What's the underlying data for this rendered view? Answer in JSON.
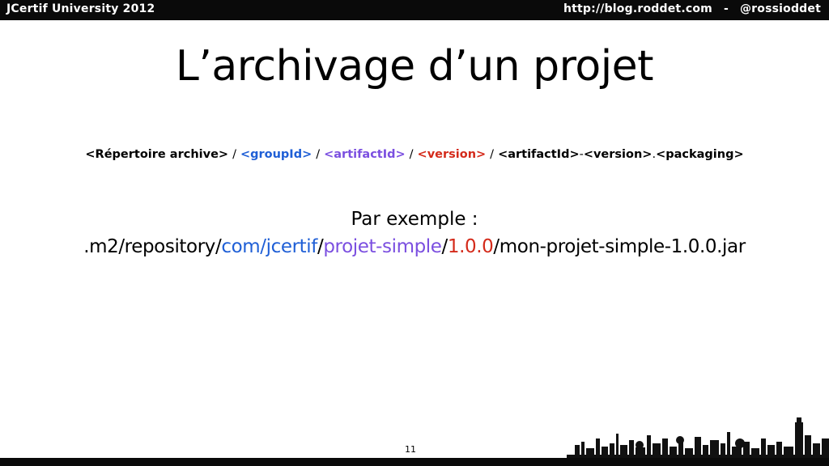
{
  "header": {
    "event": "JCertif University 2012",
    "url": "http://blog.roddet.com",
    "separator": "-",
    "handle": "@rossioddet"
  },
  "slide": {
    "title": "L’archivage d’un projet",
    "pattern": {
      "archive_dir": "<Répertoire archive>",
      "group_id": "<groupId>",
      "artifact_id": "<artifactId>",
      "version": "<version>",
      "filename_artifact": "<artifactId>",
      "filename_dash": "-",
      "filename_version": "<version>",
      "filename_dot": ".",
      "filename_packaging": "<packaging>",
      "separator": "/"
    },
    "example": {
      "label": "Par exemple :",
      "prefix": ".m2/repository/",
      "group": "com/jcertif",
      "slash1": "/",
      "artifact": "projet-simple",
      "slash2": "/",
      "version": "1.0.0",
      "file": "/mon-projet-simple-1.0.0.jar"
    },
    "page_number": "11"
  },
  "colors": {
    "group": "#1f5fd6",
    "artifact": "#7b4fe0",
    "version": "#d42a1a"
  },
  "decoration": {
    "skyline": "city-skyline-silhouette"
  }
}
